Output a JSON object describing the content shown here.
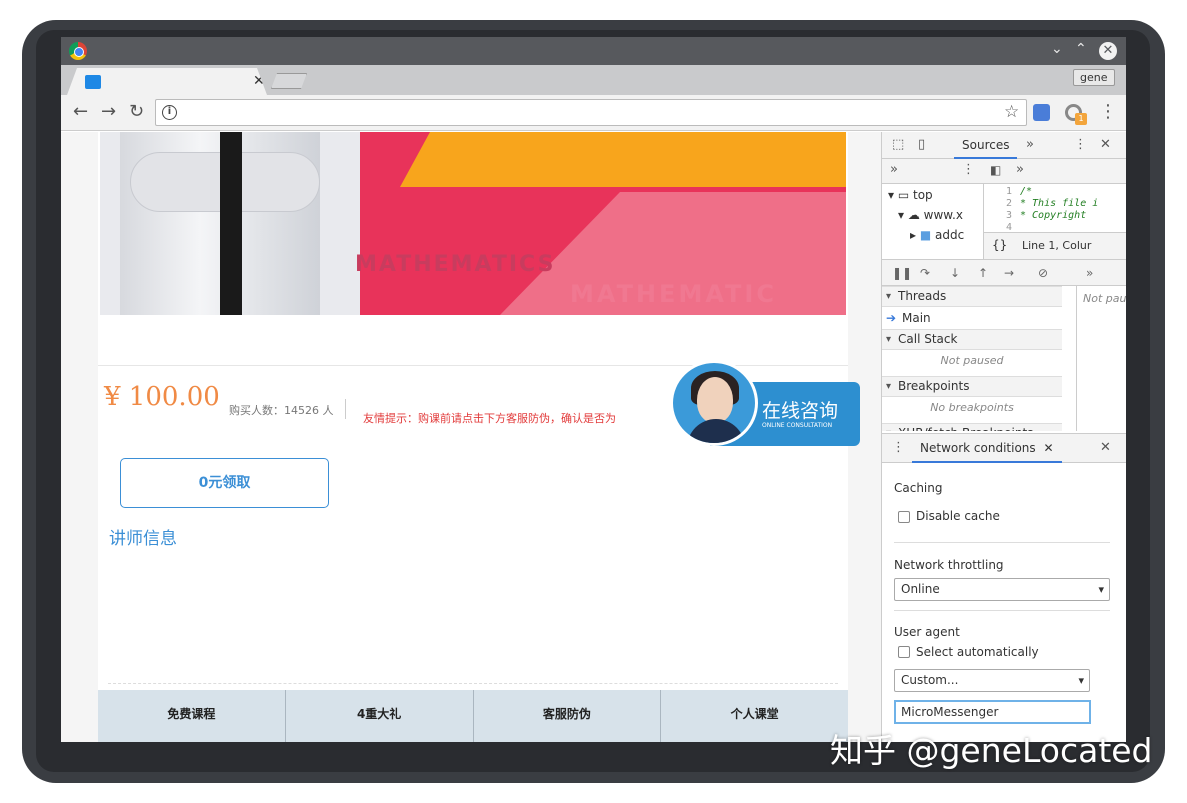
{
  "browser": {
    "profile_label": "gene",
    "tab_close": "✕",
    "window_min": "⌄",
    "window_max": "⌃",
    "window_close": "✕"
  },
  "page": {
    "banner_word": "MATHEMATICS",
    "banner_word2": "MATHEMATIC",
    "price": "¥ 100.00",
    "buyers": "购买人数：14526 人",
    "tip": "友情提示：购课前请点击下方客服防伪，确认是否为",
    "consult_title": "在线咨询",
    "consult_sub": "ONLINE CONSULTATION",
    "free_button": "0元领取",
    "teacher_heading": "讲师信息",
    "bottom_nav": [
      "免费课程",
      "4重大礼",
      "客服防伪",
      "个人课堂"
    ],
    "colors": {
      "accent": "#3b8fd6",
      "price": "#f08a45",
      "tip": "#e23a3a"
    }
  },
  "devtools": {
    "sources_tab": "Sources",
    "more": "»",
    "tree": {
      "top": "top",
      "domain": "www.x",
      "folder": "addc"
    },
    "code_lines": [
      {
        "n": "1",
        "t": "/*"
      },
      {
        "n": "2",
        "t": " * This file i"
      },
      {
        "n": "3",
        "t": " * Copyright"
      },
      {
        "n": "4",
        "t": ""
      }
    ],
    "cursor_pos": "Line 1, Colur",
    "pretty_print": "{}",
    "sections": {
      "threads": "Threads",
      "main_thread": "Main",
      "call_stack": "Call Stack",
      "not_paused": "Not paused",
      "breakpoints": "Breakpoints",
      "no_breakpoints": "No breakpoints",
      "xhr": "XHR/fetch Breakpoints",
      "scope_status": "Not pau"
    },
    "drawer_tab": "Network conditions",
    "caching_label": "Caching",
    "disable_cache": "Disable cache",
    "throttling_label": "Network throttling",
    "throttling_value": "Online",
    "ua_label": "User agent",
    "select_auto": "Select automatically",
    "ua_select": "Custom...",
    "ua_input": "MicroMessenger"
  },
  "watermark": "知乎 @geneLocated"
}
